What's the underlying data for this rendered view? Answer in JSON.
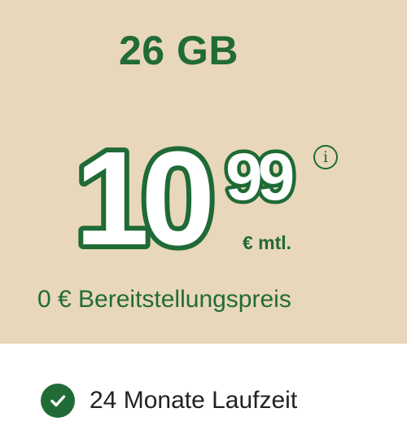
{
  "tariff": {
    "data_volume": "26 GB",
    "price": {
      "integer": "10",
      "decimals": "99",
      "unit": "€ mtl.",
      "info_icon": "info-circle-icon"
    },
    "setup_fee": "0 € Bereitstellungspreis"
  },
  "features": [
    {
      "icon": "check-circle-icon",
      "label": "24 Monate Laufzeit"
    }
  ],
  "colors": {
    "accent_green": "#216b37",
    "card_background": "#e9d7bb",
    "price_fill": "#ffffff",
    "text_dark": "#222222"
  }
}
